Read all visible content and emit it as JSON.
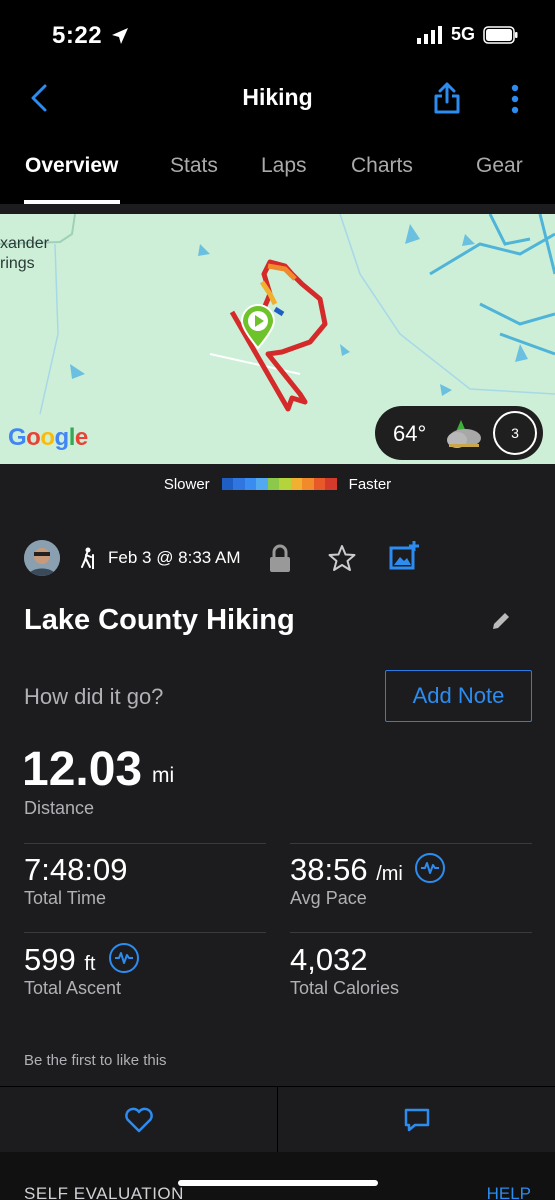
{
  "status": {
    "time": "5:22",
    "carrier": "5G"
  },
  "nav": {
    "title": "Hiking"
  },
  "tabs": [
    {
      "label": "Overview"
    },
    {
      "label": "Stats"
    },
    {
      "label": "Laps"
    },
    {
      "label": "Charts"
    },
    {
      "label": "Gear"
    }
  ],
  "map": {
    "place_label_1": "xander",
    "place_label_2": "rings",
    "google": "Google",
    "temp": "64°",
    "wind_speed": "3"
  },
  "legend": {
    "slower": "Slower",
    "faster": "Faster",
    "colors": [
      "#1f5fc4",
      "#2f76e0",
      "#3a8cf0",
      "#52a9f0",
      "#8cc94a",
      "#b5d33a",
      "#f0b030",
      "#f08a2a",
      "#e8592a",
      "#d43a2a"
    ]
  },
  "activity": {
    "date": "Feb 3 @ 8:33 AM",
    "title": "Lake County Hiking",
    "prompt": "How did it go?",
    "add_note": "Add Note"
  },
  "stats": {
    "distance": {
      "value": "12.03",
      "unit": "mi",
      "label": "Distance"
    },
    "total_time": {
      "value": "7:48:09",
      "label": "Total Time"
    },
    "avg_pace": {
      "value": "38:56",
      "unit": "/mi",
      "label": "Avg Pace"
    },
    "total_ascent": {
      "value": "599",
      "unit": "ft",
      "label": "Total Ascent"
    },
    "total_calories": {
      "value": "4,032",
      "label": "Total Calories"
    }
  },
  "social": {
    "likes_text": "Be the first to like this"
  },
  "footer": {
    "self_eval": "SELF EVALUATION",
    "help": "HELP"
  },
  "colors": {
    "accent": "#2c8cf0",
    "background": "#1c1c1e"
  }
}
